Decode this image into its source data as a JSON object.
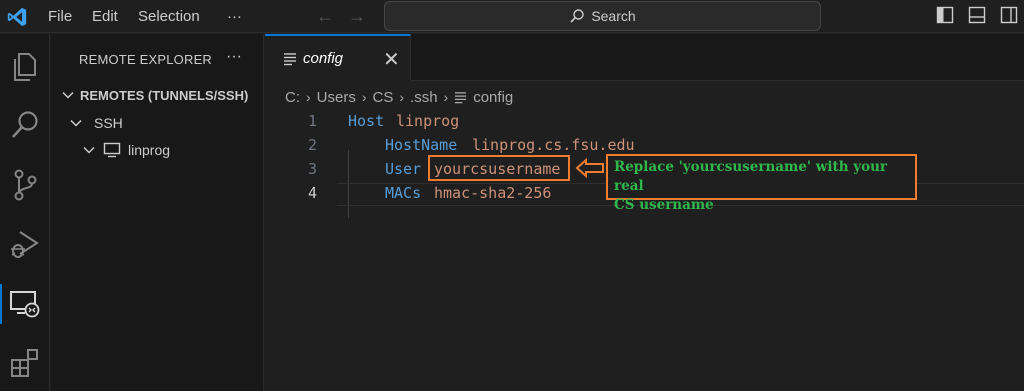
{
  "app": {
    "menu": [
      "File",
      "Edit",
      "Selection",
      "···"
    ],
    "search_placeholder": "Search"
  },
  "activity_bar": {
    "items": [
      "explorer-icon",
      "search-icon",
      "source-control-icon",
      "run-debug-icon",
      "remote-explorer-icon",
      "extensions-icon"
    ],
    "active": "remote-explorer-icon"
  },
  "sidebar": {
    "title": "REMOTE EXPLORER",
    "more": "···",
    "section": "REMOTES (TUNNELS/SSH)",
    "group": "SSH",
    "host": "linprog"
  },
  "editor": {
    "tab": {
      "label": "config",
      "close": "✕"
    },
    "breadcrumb": [
      "C:",
      "Users",
      "CS",
      ".ssh",
      "config"
    ],
    "lines": [
      {
        "num": "1",
        "key": "Host",
        "value": "linprog"
      },
      {
        "num": "2",
        "key": "HostName",
        "value": "linprog.cs.fsu.edu"
      },
      {
        "num": "3",
        "key": "User",
        "value": "yourcsusername"
      },
      {
        "num": "4",
        "key": "MACs",
        "value": "hmac-sha2-256"
      }
    ],
    "current_line": 4
  },
  "annotation": {
    "line1": "Replace 'yourcsusername' with your real",
    "line2": "CS username",
    "color_border": "#ed7d31",
    "color_text": "#2fb84c"
  }
}
